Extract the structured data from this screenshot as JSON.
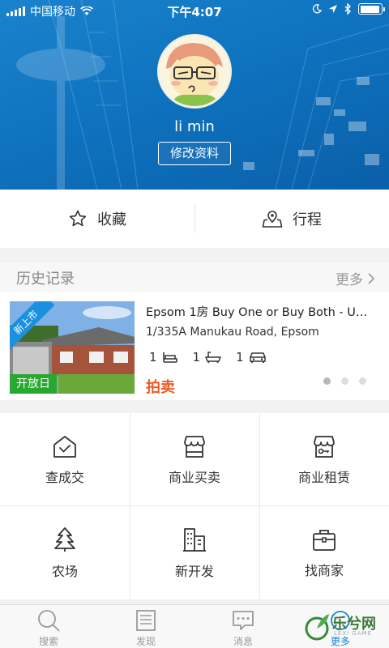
{
  "status_bar": {
    "carrier": "中国移动",
    "time": "下午4:07",
    "battery_level": 0.95
  },
  "profile": {
    "username": "li min",
    "edit_label": "修改资料"
  },
  "quick_actions": [
    {
      "label": "收藏",
      "icon": "star-icon"
    },
    {
      "label": "行程",
      "icon": "map-pin-icon"
    }
  ],
  "history": {
    "title": "历史记录",
    "more_label": "更多",
    "listing": {
      "tag_new": "新上市",
      "tag_open": "开放日",
      "title": "Epsom 1房 Buy One or Buy Both - Unit…",
      "address": "1/335A Manukau Road, Epsom",
      "bedrooms": "1",
      "bathrooms": "1",
      "garages": "1",
      "sale_type": "拍卖"
    },
    "carousel": {
      "total": 3,
      "active": 0
    }
  },
  "services": [
    {
      "label": "查成交",
      "icon": "house-check-icon"
    },
    {
      "label": "商业买卖",
      "icon": "shop-icon"
    },
    {
      "label": "商业租赁",
      "icon": "shop-key-icon"
    },
    {
      "label": "农场",
      "icon": "tree-icon"
    },
    {
      "label": "新开发",
      "icon": "buildings-icon"
    },
    {
      "label": "找商家",
      "icon": "briefcase-icon"
    }
  ],
  "tabbar": [
    {
      "label": "搜索",
      "icon": "search-icon"
    },
    {
      "label": "发现",
      "icon": "news-icon"
    },
    {
      "label": "消息",
      "icon": "message-icon"
    },
    {
      "label": "更多",
      "icon": "more-icon"
    }
  ],
  "watermark": {
    "text": "乐兮网",
    "sub": "LEXI GAME"
  },
  "colors": {
    "brand_blue": "#1a83cc",
    "sale_orange": "#f05a24",
    "open_green": "#27a830",
    "new_tag_blue": "#1b8fe0"
  }
}
